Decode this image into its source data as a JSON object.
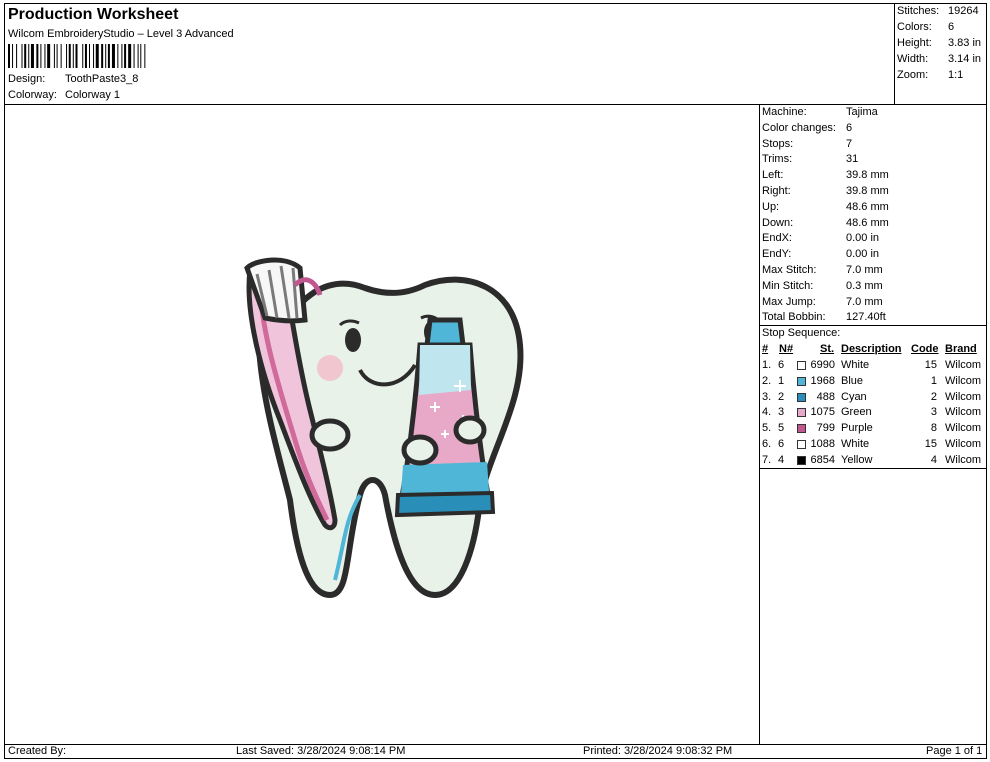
{
  "header": {
    "title": "Production Worksheet",
    "software": "Wilcom EmbroideryStudio – Level 3 Advanced",
    "design_label": "Design:",
    "design_value": "ToothPaste3_8",
    "colorway_label": "Colorway:",
    "colorway_value": "Colorway 1"
  },
  "stats": [
    {
      "label": "Stitches:",
      "value": "19264"
    },
    {
      "label": "Colors:",
      "value": "6"
    },
    {
      "label": "Height:",
      "value": "3.83 in"
    },
    {
      "label": "Width:",
      "value": "3.14 in"
    },
    {
      "label": "Zoom:",
      "value": "1:1"
    }
  ],
  "specs": [
    {
      "label": "Machine:",
      "value": "Tajima"
    },
    {
      "label": "Color changes:",
      "value": "6"
    },
    {
      "label": "Stops:",
      "value": "7"
    },
    {
      "label": "Trims:",
      "value": "31"
    },
    {
      "label": "Left:",
      "value": "39.8 mm"
    },
    {
      "label": "Right:",
      "value": "39.8 mm"
    },
    {
      "label": "Up:",
      "value": "48.6 mm"
    },
    {
      "label": "Down:",
      "value": "48.6 mm"
    },
    {
      "label": "EndX:",
      "value": "0.00 in"
    },
    {
      "label": "EndY:",
      "value": "0.00 in"
    },
    {
      "label": "Max Stitch:",
      "value": "7.0 mm"
    },
    {
      "label": "Min Stitch:",
      "value": "0.3 mm"
    },
    {
      "label": "Max Jump:",
      "value": "7.0 mm"
    },
    {
      "label": "Total Bobbin:",
      "value": "127.40ft"
    }
  ],
  "stop_sequence": {
    "title": "Stop Sequence:",
    "headers": {
      "num": "#",
      "n": "N#",
      "st": "St.",
      "description": "Description",
      "code": "Code",
      "brand": "Brand"
    },
    "rows": [
      {
        "num": "1.",
        "n": "6",
        "st": "6990",
        "description": "White",
        "code": "15",
        "brand": "Wilcom",
        "color": "#ffffff"
      },
      {
        "num": "2.",
        "n": "1",
        "st": "1968",
        "description": "Blue",
        "code": "1",
        "brand": "Wilcom",
        "color": "#4fb6d8"
      },
      {
        "num": "3.",
        "n": "2",
        "st": "488",
        "description": "Cyan",
        "code": "2",
        "brand": "Wilcom",
        "color": "#2a8fb8"
      },
      {
        "num": "4.",
        "n": "3",
        "st": "1075",
        "description": "Green",
        "code": "3",
        "brand": "Wilcom",
        "color": "#e7a9c7"
      },
      {
        "num": "5.",
        "n": "5",
        "st": "799",
        "description": "Purple",
        "code": "8",
        "brand": "Wilcom",
        "color": "#c0578f"
      },
      {
        "num": "6.",
        "n": "6",
        "st": "1088",
        "description": "White",
        "code": "15",
        "brand": "Wilcom",
        "color": "#ffffff"
      },
      {
        "num": "7.",
        "n": "4",
        "st": "6854",
        "description": "Yellow",
        "code": "4",
        "brand": "Wilcom",
        "color": "#000000"
      }
    ]
  },
  "footer": {
    "created_by": "Created By:",
    "last_saved": "Last Saved: 3/28/2024 9:08:14 PM",
    "printed": "Printed: 3/28/2024 9:08:32 PM",
    "page": "Page 1 of 1"
  }
}
